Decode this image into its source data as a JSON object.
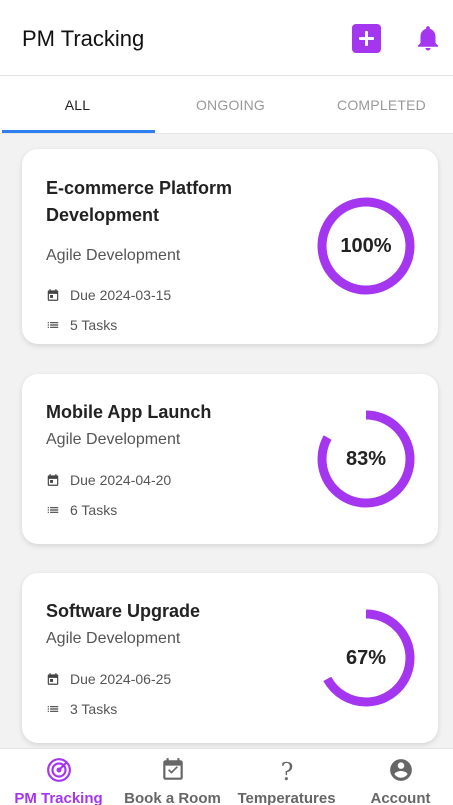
{
  "header": {
    "title": "PM Tracking"
  },
  "tabs": [
    {
      "label": "ALL",
      "active": true
    },
    {
      "label": "ONGOING",
      "active": false
    },
    {
      "label": "COMPLETED",
      "active": false
    }
  ],
  "projects": [
    {
      "name": "E-commerce Platform Development",
      "category": "Agile Development",
      "due": "Due 2024-03-15",
      "tasks": "5 Tasks",
      "progress": 100,
      "progress_label": "100%"
    },
    {
      "name": "Mobile App Launch",
      "category": "Agile Development",
      "due": "Due 2024-04-20",
      "tasks": "6 Tasks",
      "progress": 83,
      "progress_label": "83%"
    },
    {
      "name": "Software Upgrade",
      "category": "Agile Development",
      "due": "Due 2024-06-25",
      "tasks": "3 Tasks",
      "progress": 67,
      "progress_label": "67%"
    }
  ],
  "nav": [
    {
      "label": "PM Tracking",
      "icon": "target-icon",
      "active": true
    },
    {
      "label": "Book a Room",
      "icon": "calendar-check-icon",
      "active": false
    },
    {
      "label": "Temperatures",
      "icon": "question-icon",
      "active": false
    },
    {
      "label": "Account",
      "icon": "account-icon",
      "active": false
    }
  ],
  "colors": {
    "accent": "#a436f0",
    "tab_indicator": "#2d7ff0",
    "ring_track": "#ffffff"
  }
}
